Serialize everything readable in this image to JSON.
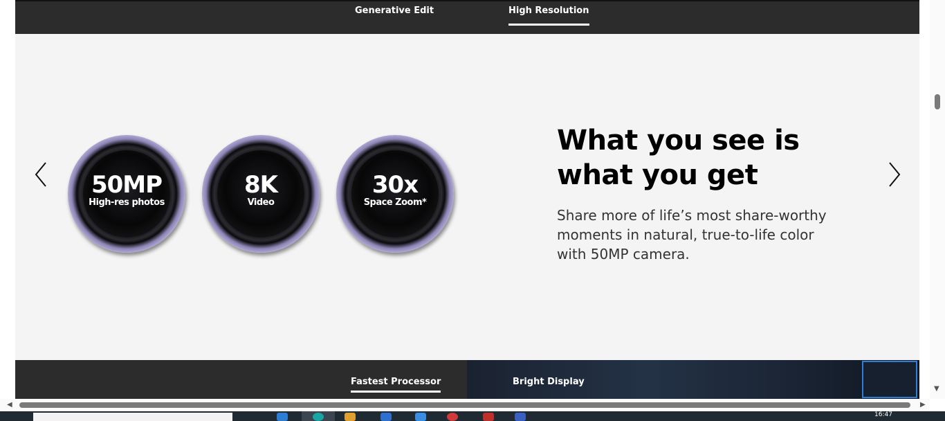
{
  "top_tabs": [
    {
      "label": "Generative Edit",
      "active": false
    },
    {
      "label": "High Resolution",
      "active": true
    }
  ],
  "slide": {
    "headline_line1": "What you see is",
    "headline_line2": "what you get",
    "body": "Share more of life’s most share-worthy moments in natural, true-to-life color with 50MP camera.",
    "lenses": [
      {
        "big": "50MP",
        "small": "High-res photos"
      },
      {
        "big": "8K",
        "small": "Video"
      },
      {
        "big": "30x",
        "small": "Space Zoom*"
      }
    ]
  },
  "bottom_tabs": [
    {
      "label": "Fastest Processor",
      "active": true
    },
    {
      "label": "Bright Display",
      "active": false
    }
  ],
  "taskbar": {
    "clock": "16:47"
  },
  "colors": {
    "bar_bg": "#2c2c2c",
    "panel_bg": "#f4f4f4",
    "lens_ring": "#b8b1dc",
    "thumb_border": "#2e7fd6"
  }
}
